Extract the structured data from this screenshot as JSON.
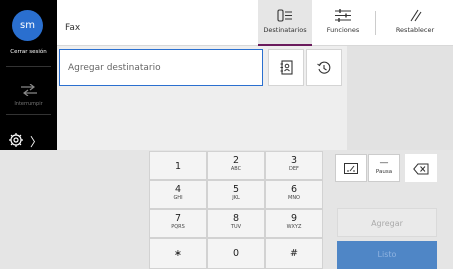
{
  "rail": {
    "avatar_initials": "sm",
    "signout_label": "Cerrar sesión",
    "interrupt_label": "Interrumpir",
    "icons": [
      "gear-icon",
      "chevron-right-icon",
      "interrupt-icon"
    ]
  },
  "header": {
    "title": "Fax",
    "recipients_label": "Destinatarios",
    "functions_label": "Funciones",
    "reset_label": "Restablecer",
    "active_accent": "#6a1b5c"
  },
  "recipient": {
    "placeholder": "Agregar destinatario",
    "accent": "#2a6fcf",
    "icons": [
      "address-book-icon",
      "history-icon"
    ]
  },
  "keypad": {
    "keys": [
      {
        "num": "1",
        "sub": ""
      },
      {
        "num": "2",
        "sub": "ABC"
      },
      {
        "num": "3",
        "sub": "DEF"
      },
      {
        "num": "4",
        "sub": "GHI"
      },
      {
        "num": "5",
        "sub": "JKL"
      },
      {
        "num": "6",
        "sub": "MNO"
      },
      {
        "num": "7",
        "sub": "PQRS"
      },
      {
        "num": "8",
        "sub": "TUV"
      },
      {
        "num": "9",
        "sub": "WXYZ"
      },
      {
        "num": "∗",
        "sub": ""
      },
      {
        "num": "0",
        "sub": ""
      },
      {
        "num": "#",
        "sub": ""
      }
    ]
  },
  "functions": {
    "pause_symbol": "—",
    "pause_label": "Pausa",
    "add_label": "Agregar",
    "done_label": "Listo",
    "done_color": "#4f86c6"
  }
}
